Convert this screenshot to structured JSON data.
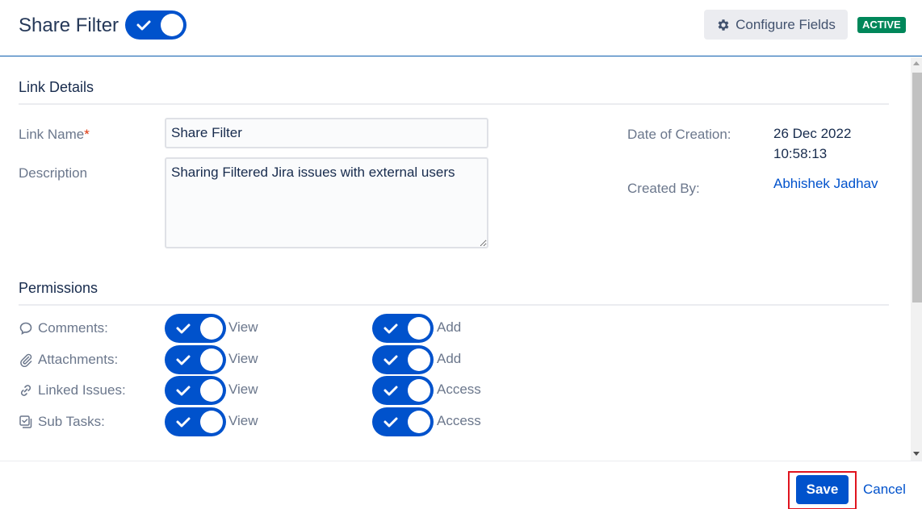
{
  "header": {
    "title": "Share Filter",
    "enabled_toggle": true,
    "configure_fields_label": "Configure Fields",
    "status_badge": "ACTIVE"
  },
  "link_details": {
    "section_title": "Link Details",
    "link_name_label": "Link Name",
    "required_marker": "*",
    "link_name_value": "Share Filter",
    "description_label": "Description",
    "description_value": "Sharing Filtered Jira issues with external users",
    "date_of_creation_label": "Date of Creation:",
    "date_of_creation_date": "26 Dec 2022",
    "date_of_creation_time": "10:58:13",
    "created_by_label": "Created By:",
    "created_by_value": "Abhishek Jadhav"
  },
  "permissions": {
    "section_title": "Permissions",
    "rows": [
      {
        "icon": "comment-icon",
        "label": "Comments:",
        "first": {
          "label": "View",
          "on": true
        },
        "second": {
          "label": "Add",
          "on": true
        }
      },
      {
        "icon": "attachment-icon",
        "label": "Attachments:",
        "first": {
          "label": "View",
          "on": true
        },
        "second": {
          "label": "Add",
          "on": true
        }
      },
      {
        "icon": "link-icon",
        "label": "Linked Issues:",
        "first": {
          "label": "View",
          "on": true
        },
        "second": {
          "label": "Access",
          "on": true
        }
      },
      {
        "icon": "subtask-icon",
        "label": "Sub Tasks:",
        "first": {
          "label": "View",
          "on": true
        },
        "second": {
          "label": "Access",
          "on": true
        }
      }
    ]
  },
  "footer": {
    "save_label": "Save",
    "cancel_label": "Cancel"
  },
  "colors": {
    "primary": "#0052cc",
    "active_badge": "#00875a",
    "highlight_box": "#e0141e"
  }
}
